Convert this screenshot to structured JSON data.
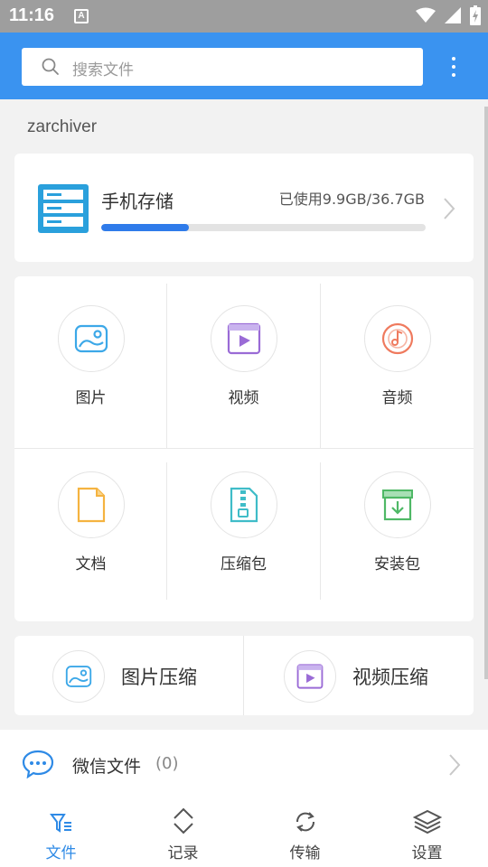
{
  "status_bar": {
    "time": "11:16",
    "notification_icon": "A"
  },
  "search": {
    "placeholder": "搜索文件"
  },
  "section": {
    "title": "zarchiver"
  },
  "storage": {
    "label": "手机存储",
    "usage": "已使用9.9GB/36.7GB",
    "used_fraction": 0.27
  },
  "categories": [
    {
      "label": "图片",
      "icon": "image-icon",
      "color": "#3ca8e8"
    },
    {
      "label": "视频",
      "icon": "video-icon",
      "color": "#9a6bd6"
    },
    {
      "label": "音频",
      "icon": "audio-icon",
      "color": "#ef7a5e"
    },
    {
      "label": "文档",
      "icon": "document-icon",
      "color": "#f5b340"
    },
    {
      "label": "压缩包",
      "icon": "archive-icon",
      "color": "#3fbcc8"
    },
    {
      "label": "安装包",
      "icon": "package-icon",
      "color": "#4fb866"
    }
  ],
  "compress": [
    {
      "label": "图片压缩",
      "icon": "image-icon"
    },
    {
      "label": "视频压缩",
      "icon": "video-icon"
    }
  ],
  "wechat": {
    "label": "微信文件",
    "count": "(0)"
  },
  "nav": [
    {
      "label": "文件",
      "icon": "filter-files-icon",
      "active": true
    },
    {
      "label": "记录",
      "icon": "updown-icon",
      "active": false
    },
    {
      "label": "传输",
      "icon": "sync-icon",
      "active": false
    },
    {
      "label": "设置",
      "icon": "layers-icon",
      "active": false
    }
  ],
  "colors": {
    "accent": "#3a93f0",
    "active_tab": "#2e8ae6"
  }
}
